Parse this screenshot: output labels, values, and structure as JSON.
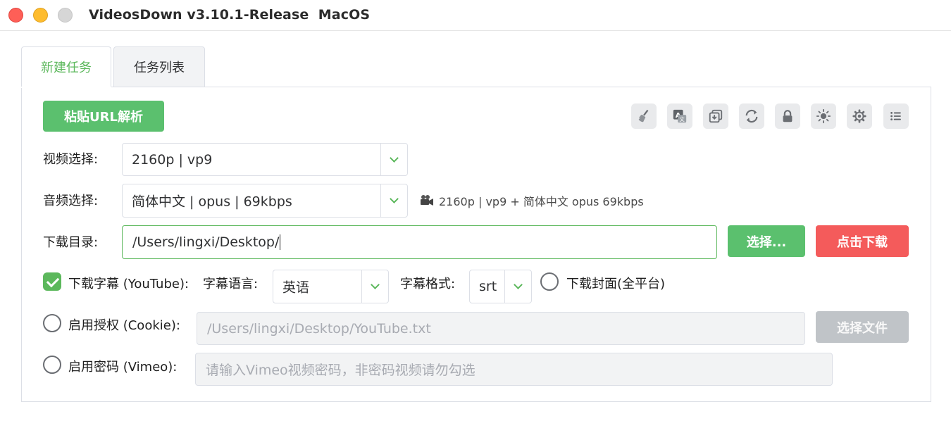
{
  "window": {
    "title": "VideosDown v3.10.1-Release  MacOS"
  },
  "tabs": [
    {
      "label": "新建任务",
      "active": true
    },
    {
      "label": "任务列表",
      "active": false
    }
  ],
  "toolbar": {
    "paste_button": "粘贴URL解析",
    "icons": [
      "broom-icon",
      "translate-icon",
      "copy-icon",
      "refresh-icon",
      "lock-icon",
      "brightness-icon",
      "settings-icon",
      "list-icon"
    ]
  },
  "video": {
    "label": "视频选择:",
    "value": "2160p | vp9"
  },
  "audio": {
    "label": "音频选择:",
    "value": "简体中文 | opus | 69kbps"
  },
  "summary": {
    "text": "2160p | vp9 + 简体中文 opus 69kbps"
  },
  "download_dir": {
    "label": "下载目录:",
    "value": "/Users/lingxi/Desktop/",
    "choose_button": "选择...",
    "download_button": "点击下载"
  },
  "subtitles": {
    "checkbox_label": "下载字幕 (YouTube):",
    "checked": true,
    "language_label": "字幕语言:",
    "language_value": "英语",
    "format_label": "字幕格式:",
    "format_value": "srt",
    "cover_label": "下载封面(全平台)",
    "cover_checked": false
  },
  "cookie": {
    "checkbox_label": "启用授权 (Cookie):",
    "checked": false,
    "path_value": "/Users/lingxi/Desktop/YouTube.txt",
    "choose_button": "选择文件"
  },
  "vimeo": {
    "checkbox_label": "启用密码 (Vimeo):",
    "checked": false,
    "placeholder": "请输入Vimeo视频密码，非密码视频请勿勾选"
  },
  "colors": {
    "accent": "#5bc06e",
    "danger": "#f45b5b",
    "disabled": "#c0c4c8"
  }
}
